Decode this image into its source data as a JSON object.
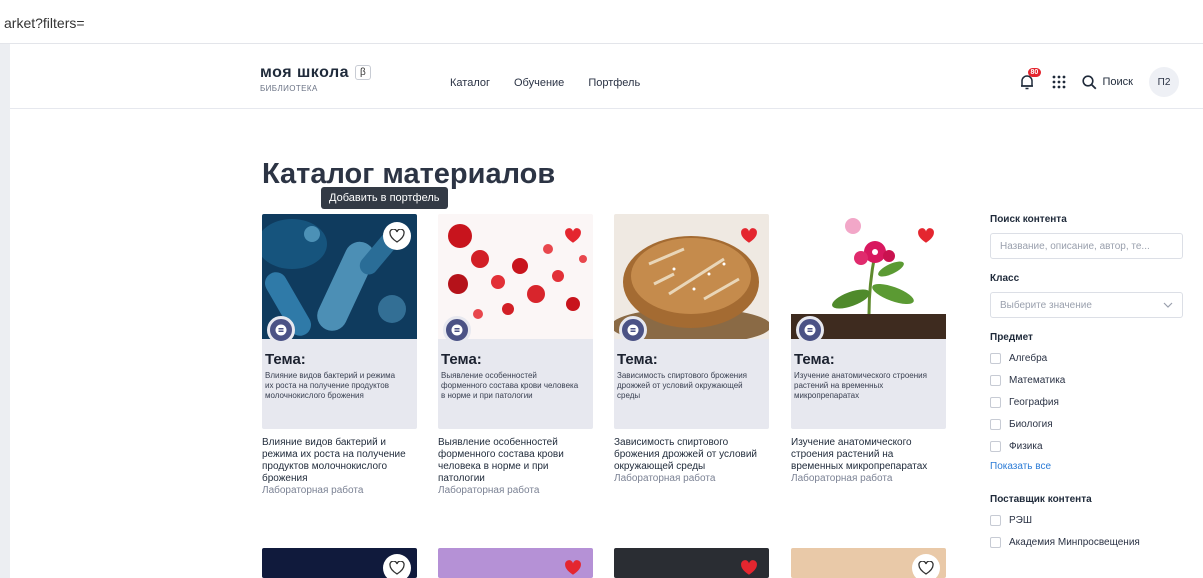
{
  "browser": {
    "url": "arket?filters="
  },
  "header": {
    "logo_title": "моя школа",
    "beta": "β",
    "logo_sub": "БИБЛИОТЕКА",
    "nav": [
      "Каталог",
      "Обучение",
      "Портфель"
    ],
    "notifications_badge": "80",
    "search_label": "Поиск",
    "avatar": "П2"
  },
  "page": {
    "title": "Каталог материалов",
    "tooltip": "Добавить в портфель"
  },
  "colors": {
    "accent": "#4b5285",
    "favorite": "#e4262f",
    "link": "#2b7bd6"
  },
  "cards": [
    {
      "plate_title": "Тема:",
      "plate_text": "Влияние видов бактерий и режима их роста на получение продуктов молочнокислого брожения",
      "description": "Влияние видов бактерий и режима их роста на получение продуктов молочнокислого брожения",
      "type": "Лабораторная работа",
      "favorite": false,
      "icon": "heart-outline-icon"
    },
    {
      "plate_title": "Тема:",
      "plate_text": "Выявление особенностей форменного состава крови человека в норме и при патологии",
      "description": "Выявление особенностей форменного состава крови человека в норме и при патологии",
      "type": "Лабораторная работа",
      "favorite": true,
      "icon": "heart-filled-icon"
    },
    {
      "plate_title": "Тема:",
      "plate_text": "Зависимость спиртового брожения дрожжей от условий окружающей среды",
      "description": "Зависимость спиртового брожения дрожжей от условий окружающей среды",
      "type": "Лабораторная работа",
      "favorite": true,
      "icon": "heart-filled-icon"
    },
    {
      "plate_title": "Тема:",
      "plate_text": "Изучение анатомического строения растений на временных микропрепаратах",
      "description": "Изучение анатомического строения растений на временных микропрепаратах",
      "type": "Лабораторная работа",
      "favorite": true,
      "icon": "heart-filled-icon"
    }
  ],
  "sidebar": {
    "search_label": "Поиск контента",
    "search_placeholder": "Название, описание, автор, те...",
    "class_label": "Класс",
    "class_placeholder": "Выберите значение",
    "subject_label": "Предмет",
    "subjects": [
      "Алгебра",
      "Математика",
      "География",
      "Биология",
      "Физика"
    ],
    "show_all": "Показать все",
    "provider_label": "Поставщик контента",
    "providers": [
      "РЭШ",
      "Академия Минпросвещения"
    ]
  }
}
